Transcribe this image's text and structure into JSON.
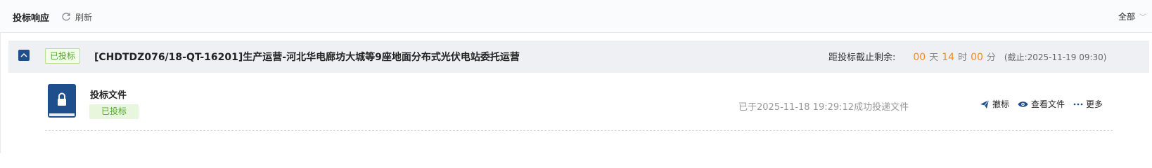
{
  "header": {
    "title": "投标响应",
    "refresh_label": "刷新",
    "filter_label": "全部"
  },
  "tender": {
    "status": "已投标",
    "title": "[CHDTDZ076/18-QT-16201]生产运营-河北华电廊坊大城等9座地面分布式光伏电站委托运营",
    "countdown_label": "距投标截止剩余:",
    "days": "00",
    "days_unit": "天",
    "hours": "14",
    "hours_unit": "时",
    "minutes": "00",
    "minutes_unit": "分",
    "deadline": "(截止:2025-11-19 09:30)"
  },
  "document": {
    "name": "投标文件",
    "status": "已投标",
    "submit_info": "已于2025-11-18 19:29:12成功投递文件",
    "actions": {
      "withdraw": "撤标",
      "view": "查看文件",
      "more": "更多"
    }
  },
  "colors": {
    "accent_orange": "#f08a24",
    "primary_blue": "#1f4e8c",
    "success_green": "#52a82a"
  }
}
